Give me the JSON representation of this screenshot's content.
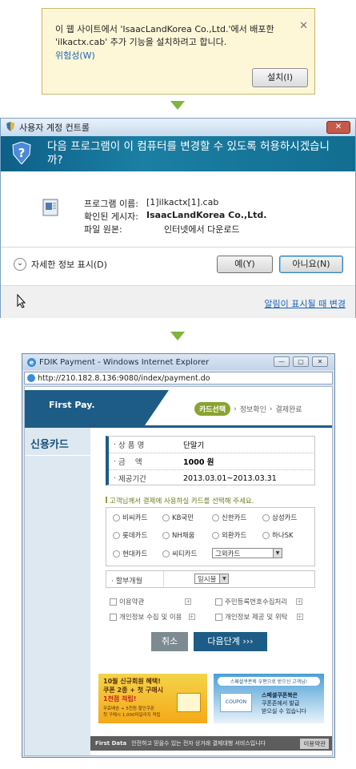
{
  "infobar": {
    "message": "이 웹 사이트에서 'IsaacLandKorea Co.,Ltd.'에서 배포한 'ilkactx.cab' 추가 기능을 설치하려고 합니다.",
    "risk_link": "위험성(W)",
    "install_button": "설치(I)"
  },
  "uac": {
    "title": "사용자 계정 컨트롤",
    "question": "다음 프로그램이 이 컴퓨터를 변경할 수 있도록 허용하시겠습니까?",
    "program_label": "프로그램 이름:",
    "program_value": "[1]ilkactx[1].cab",
    "publisher_label": "확인된 게시자:",
    "publisher_value": "IsaacLandKorea Co.,Ltd.",
    "origin_label": "파일 원본:",
    "origin_value": "인터넷에서 다운로드",
    "details_toggle": "자세한 정보 표시(D)",
    "yes_button": "예(Y)",
    "no_button": "아니요(N)",
    "change_link": "알림이 표시될 때 변경"
  },
  "ie": {
    "title": "FDIK Payment - Windows Internet Explorer",
    "url": "http://210.182.8.136:9080/index/payment.do",
    "brand": "First Pay.",
    "steps": [
      "카드선택",
      "정보확인",
      "결제완료"
    ],
    "sidebar_title": "신용카드",
    "product": {
      "name_label": "상 품 명",
      "name_value": "단말기",
      "amount_label": "금    액",
      "amount_value": "1000 원",
      "period_label": "제공기간",
      "period_value": "2013.03.01~2013.03.31"
    },
    "notice": "고객님께서 결제에 사용하실 카드를 선택해 주세요.",
    "cards": [
      "비씨카드",
      "KB국민",
      "신한카드",
      "삼성카드",
      "롯데카드",
      "NH채움",
      "외환카드",
      "하나SK",
      "현대카드",
      "씨티카드"
    ],
    "other_card": "그외카드",
    "installment_label": "할부개월",
    "installment_value": "일시불",
    "agreements": [
      "이용약관",
      "주민등록번호수집처리",
      "개인정보 수집 및 이용",
      "개인정보 제공 및 위탁"
    ],
    "cancel_button": "취소",
    "next_button": "다음단계 ›››",
    "ad1": {
      "line1": "10월 신규회원 혜택!",
      "line2": "쿠폰 2종 + 첫 구매시",
      "line3": "1천점 적립!",
      "line4": "무료배송 + 5천원 할인쿠폰",
      "line5": "첫 구매시 1,000마일리지 적립"
    },
    "ad2": {
      "line1": "스페셜쿠폰북 우편으로 받으신 고객님!",
      "line2": "스페셜쿠폰북은",
      "line3": "쿠폰존에서 발급",
      "line4": "받으실 수 있습니다",
      "coupon": "COUPON"
    },
    "footer_brand": "First Data",
    "footer_text": "안전하고 믿을수 있는 전자 상거래 결제대행 서비스입니다",
    "footer_button": "이용약관"
  }
}
